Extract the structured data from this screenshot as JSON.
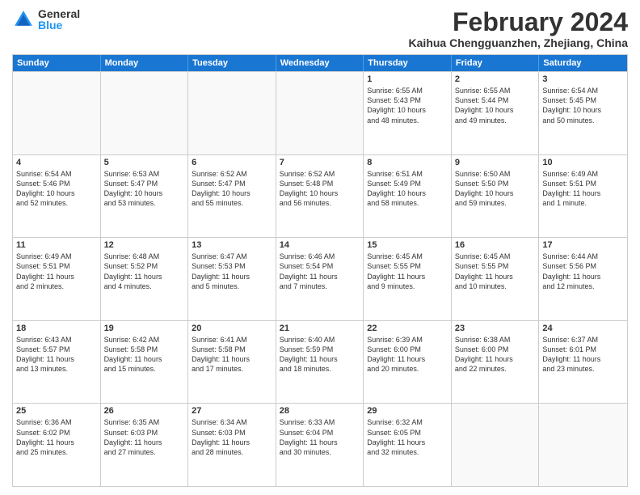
{
  "logo": {
    "general": "General",
    "blue": "Blue"
  },
  "title": "February 2024",
  "subtitle": "Kaihua Chengguanzhen, Zhejiang, China",
  "headers": [
    "Sunday",
    "Monday",
    "Tuesday",
    "Wednesday",
    "Thursday",
    "Friday",
    "Saturday"
  ],
  "weeks": [
    [
      {
        "day": "",
        "info": ""
      },
      {
        "day": "",
        "info": ""
      },
      {
        "day": "",
        "info": ""
      },
      {
        "day": "",
        "info": ""
      },
      {
        "day": "1",
        "info": "Sunrise: 6:55 AM\nSunset: 5:43 PM\nDaylight: 10 hours\nand 48 minutes."
      },
      {
        "day": "2",
        "info": "Sunrise: 6:55 AM\nSunset: 5:44 PM\nDaylight: 10 hours\nand 49 minutes."
      },
      {
        "day": "3",
        "info": "Sunrise: 6:54 AM\nSunset: 5:45 PM\nDaylight: 10 hours\nand 50 minutes."
      }
    ],
    [
      {
        "day": "4",
        "info": "Sunrise: 6:54 AM\nSunset: 5:46 PM\nDaylight: 10 hours\nand 52 minutes."
      },
      {
        "day": "5",
        "info": "Sunrise: 6:53 AM\nSunset: 5:47 PM\nDaylight: 10 hours\nand 53 minutes."
      },
      {
        "day": "6",
        "info": "Sunrise: 6:52 AM\nSunset: 5:47 PM\nDaylight: 10 hours\nand 55 minutes."
      },
      {
        "day": "7",
        "info": "Sunrise: 6:52 AM\nSunset: 5:48 PM\nDaylight: 10 hours\nand 56 minutes."
      },
      {
        "day": "8",
        "info": "Sunrise: 6:51 AM\nSunset: 5:49 PM\nDaylight: 10 hours\nand 58 minutes."
      },
      {
        "day": "9",
        "info": "Sunrise: 6:50 AM\nSunset: 5:50 PM\nDaylight: 10 hours\nand 59 minutes."
      },
      {
        "day": "10",
        "info": "Sunrise: 6:49 AM\nSunset: 5:51 PM\nDaylight: 11 hours\nand 1 minute."
      }
    ],
    [
      {
        "day": "11",
        "info": "Sunrise: 6:49 AM\nSunset: 5:51 PM\nDaylight: 11 hours\nand 2 minutes."
      },
      {
        "day": "12",
        "info": "Sunrise: 6:48 AM\nSunset: 5:52 PM\nDaylight: 11 hours\nand 4 minutes."
      },
      {
        "day": "13",
        "info": "Sunrise: 6:47 AM\nSunset: 5:53 PM\nDaylight: 11 hours\nand 5 minutes."
      },
      {
        "day": "14",
        "info": "Sunrise: 6:46 AM\nSunset: 5:54 PM\nDaylight: 11 hours\nand 7 minutes."
      },
      {
        "day": "15",
        "info": "Sunrise: 6:45 AM\nSunset: 5:55 PM\nDaylight: 11 hours\nand 9 minutes."
      },
      {
        "day": "16",
        "info": "Sunrise: 6:45 AM\nSunset: 5:55 PM\nDaylight: 11 hours\nand 10 minutes."
      },
      {
        "day": "17",
        "info": "Sunrise: 6:44 AM\nSunset: 5:56 PM\nDaylight: 11 hours\nand 12 minutes."
      }
    ],
    [
      {
        "day": "18",
        "info": "Sunrise: 6:43 AM\nSunset: 5:57 PM\nDaylight: 11 hours\nand 13 minutes."
      },
      {
        "day": "19",
        "info": "Sunrise: 6:42 AM\nSunset: 5:58 PM\nDaylight: 11 hours\nand 15 minutes."
      },
      {
        "day": "20",
        "info": "Sunrise: 6:41 AM\nSunset: 5:58 PM\nDaylight: 11 hours\nand 17 minutes."
      },
      {
        "day": "21",
        "info": "Sunrise: 6:40 AM\nSunset: 5:59 PM\nDaylight: 11 hours\nand 18 minutes."
      },
      {
        "day": "22",
        "info": "Sunrise: 6:39 AM\nSunset: 6:00 PM\nDaylight: 11 hours\nand 20 minutes."
      },
      {
        "day": "23",
        "info": "Sunrise: 6:38 AM\nSunset: 6:00 PM\nDaylight: 11 hours\nand 22 minutes."
      },
      {
        "day": "24",
        "info": "Sunrise: 6:37 AM\nSunset: 6:01 PM\nDaylight: 11 hours\nand 23 minutes."
      }
    ],
    [
      {
        "day": "25",
        "info": "Sunrise: 6:36 AM\nSunset: 6:02 PM\nDaylight: 11 hours\nand 25 minutes."
      },
      {
        "day": "26",
        "info": "Sunrise: 6:35 AM\nSunset: 6:03 PM\nDaylight: 11 hours\nand 27 minutes."
      },
      {
        "day": "27",
        "info": "Sunrise: 6:34 AM\nSunset: 6:03 PM\nDaylight: 11 hours\nand 28 minutes."
      },
      {
        "day": "28",
        "info": "Sunrise: 6:33 AM\nSunset: 6:04 PM\nDaylight: 11 hours\nand 30 minutes."
      },
      {
        "day": "29",
        "info": "Sunrise: 6:32 AM\nSunset: 6:05 PM\nDaylight: 11 hours\nand 32 minutes."
      },
      {
        "day": "",
        "info": ""
      },
      {
        "day": "",
        "info": ""
      }
    ]
  ]
}
